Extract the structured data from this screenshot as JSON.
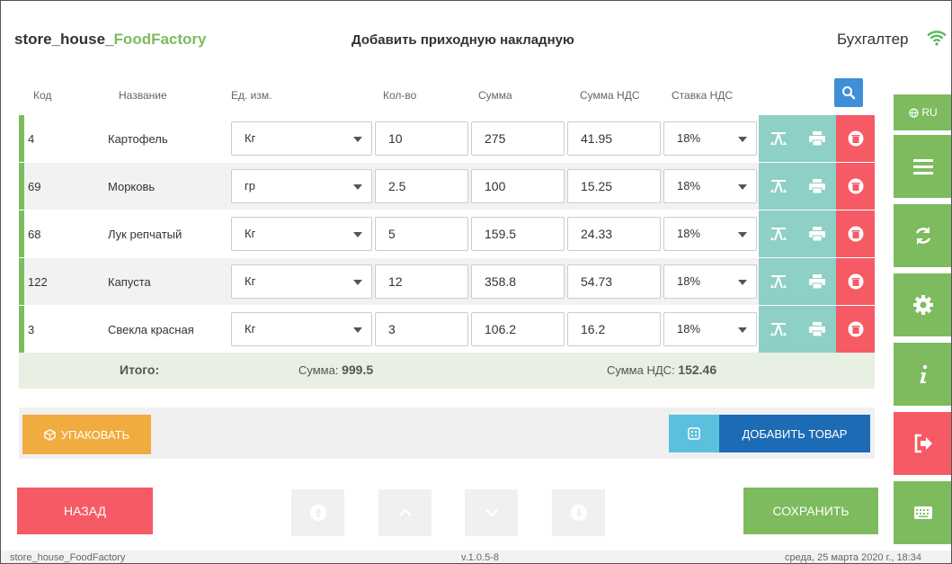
{
  "app": {
    "name_prefix": "store_house_",
    "name_suffix": "FoodFactory",
    "page_title": "Добавить приходную накладную",
    "user_role": "Бухгалтер"
  },
  "colors": {
    "accent_green": "#7dbb5e",
    "danger_red": "#f65a64",
    "primary_blue": "#1e6bb5",
    "teal": "#8ecfc6",
    "orange": "#f0ac3e"
  },
  "table": {
    "headers": {
      "code": "Код",
      "name": "Название",
      "unit": "Ед. изм.",
      "qty": "Кол-во",
      "sum": "Сумма",
      "vat_sum": "Сумма НДС",
      "vat_rate": "Ставка НДС"
    },
    "rows": [
      {
        "code": "4",
        "name": "Картофель",
        "unit": "Кг",
        "qty": "10",
        "sum": "275",
        "vat_sum": "41.95",
        "vat_rate": "18%"
      },
      {
        "code": "69",
        "name": "Морковь",
        "unit": "гр",
        "qty": "2.5",
        "sum": "100",
        "vat_sum": "15.25",
        "vat_rate": "18%"
      },
      {
        "code": "68",
        "name": "Лук репчатый",
        "unit": "Кг",
        "qty": "5",
        "sum": "159.5",
        "vat_sum": "24.33",
        "vat_rate": "18%"
      },
      {
        "code": "122",
        "name": "Капуста",
        "unit": "Кг",
        "qty": "12",
        "sum": "358.8",
        "vat_sum": "54.73",
        "vat_rate": "18%"
      },
      {
        "code": "3",
        "name": "Свекла красная",
        "unit": "Кг",
        "qty": "3",
        "sum": "106.2",
        "vat_sum": "16.2",
        "vat_rate": "18%"
      }
    ]
  },
  "totals": {
    "label": "Итого:",
    "sum_label": "Сумма:",
    "sum_value": "999.5",
    "vat_label": "Сумма НДС:",
    "vat_value": "152.46"
  },
  "toolbar": {
    "pack_label": "УПАКОВАТЬ",
    "add_label": "ДОБАВИТЬ ТОВАР"
  },
  "nav": {
    "back_label": "НАЗАД",
    "save_label": "СОХРАНИТЬ"
  },
  "sidebar": {
    "lang_label": "RU",
    "icons": [
      "globe-icon",
      "menu-icon",
      "sync-icon",
      "gear-icon",
      "info-icon",
      "logout-icon",
      "keyboard-icon"
    ]
  },
  "footer": {
    "app_name": "store_house_FoodFactory",
    "version": "v.1.0.5-8",
    "datetime": "среда, 25 марта 2020 г., 18:34"
  }
}
